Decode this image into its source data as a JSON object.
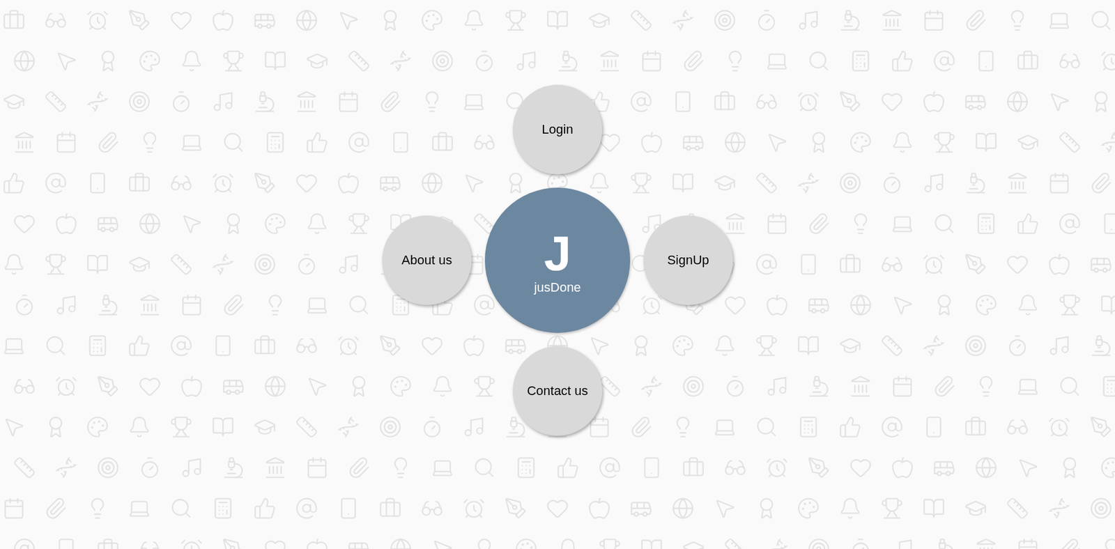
{
  "brand": {
    "letter": "J",
    "name": "jusDone"
  },
  "menu": [
    {
      "label": "Login"
    },
    {
      "label": "SignUp"
    },
    {
      "label": "Contact us"
    },
    {
      "label": "About us"
    }
  ]
}
